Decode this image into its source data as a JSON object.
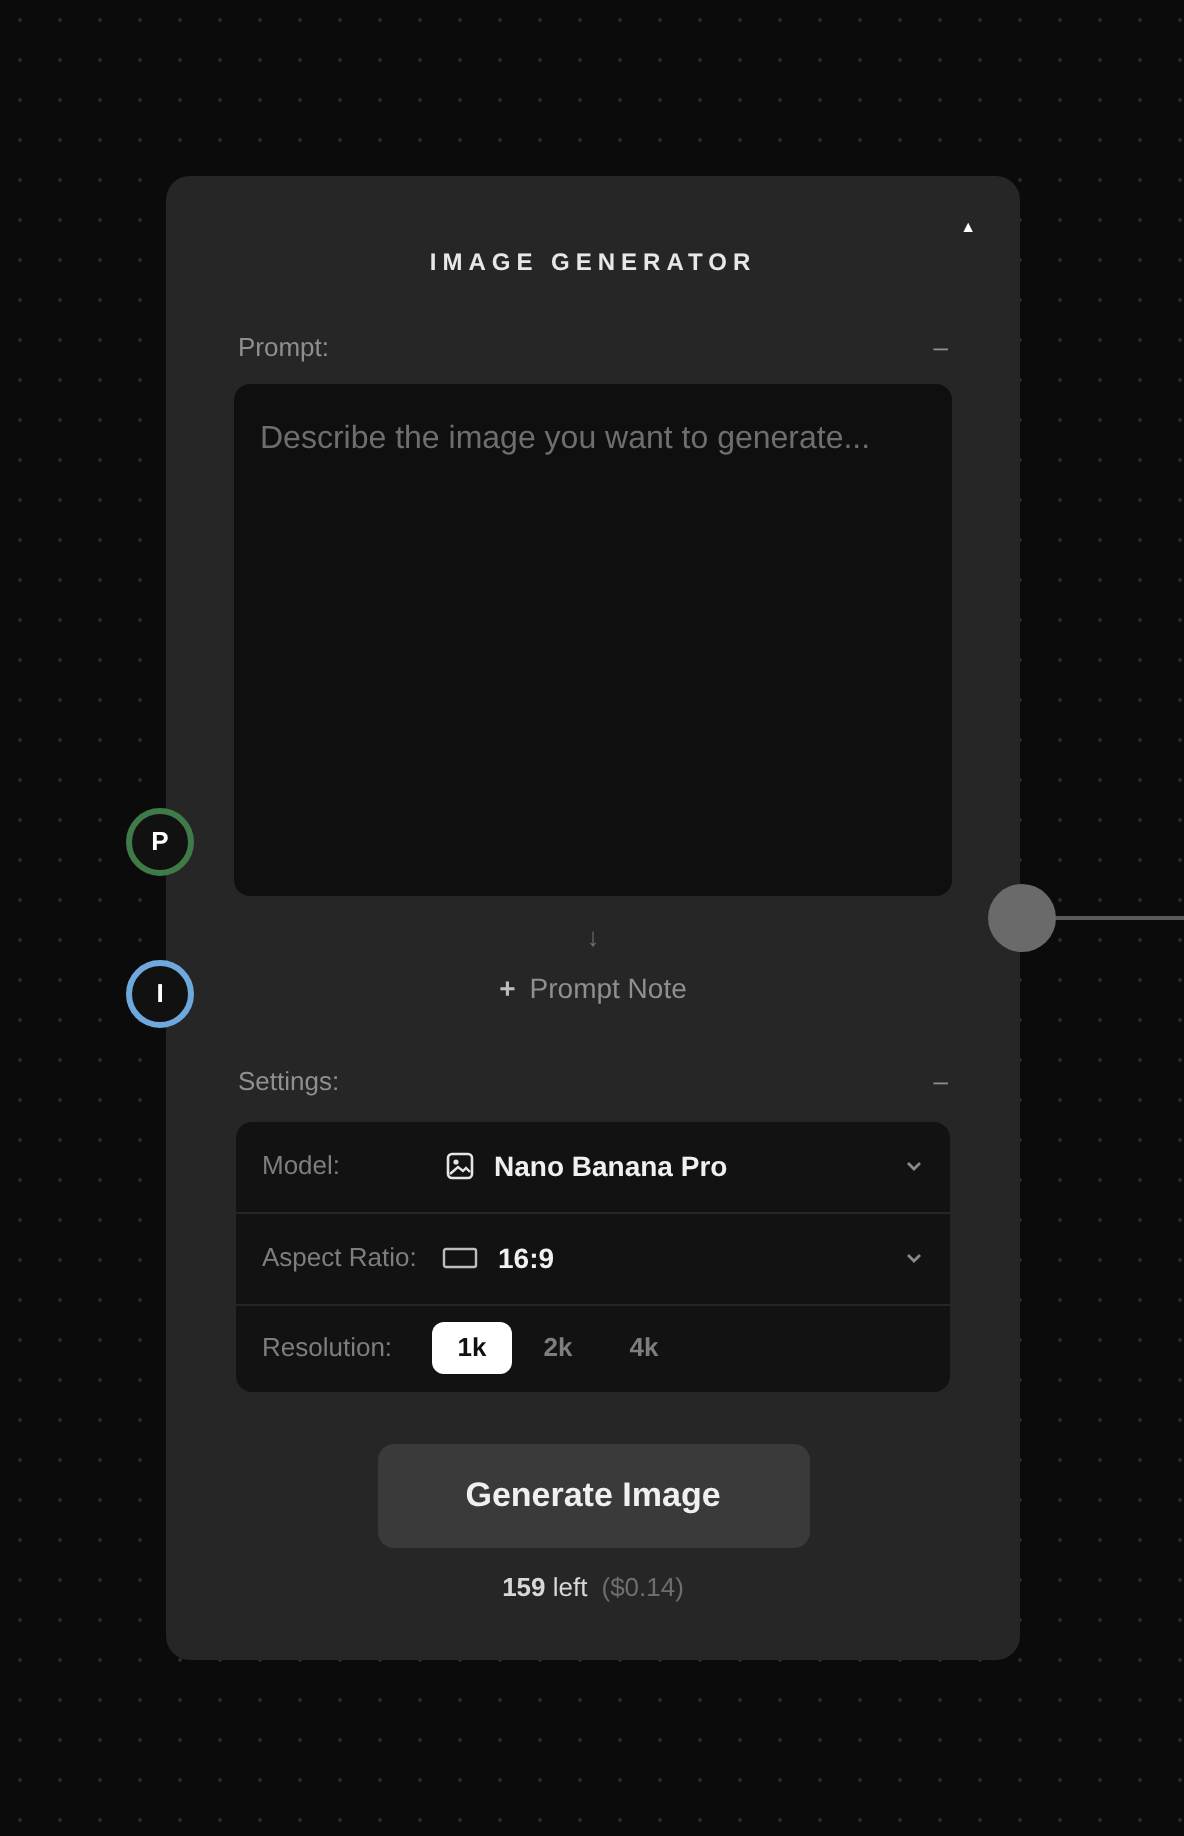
{
  "node": {
    "title": "IMAGE GENERATOR",
    "collapse_icon": "▲",
    "prompt": {
      "label": "Prompt:",
      "collapse": "–",
      "placeholder": "Describe the image you want to generate..."
    },
    "prompt_note": {
      "arrow": "↓",
      "plus": "+",
      "label": "Prompt Note"
    },
    "settings": {
      "label": "Settings:",
      "collapse": "–",
      "rows": [
        {
          "kind": "select",
          "label": "Model:",
          "value": "Nano Banana Pro"
        },
        {
          "kind": "select",
          "label": "Aspect Ratio:",
          "value": "16:9"
        },
        {
          "kind": "segmented",
          "label": "Resolution:",
          "options": [
            {
              "label": "1k",
              "selected": true
            },
            {
              "label": "2k",
              "selected": false
            },
            {
              "label": "4k",
              "selected": false
            }
          ]
        }
      ]
    },
    "button": "Generate Image",
    "credits": {
      "count": "159",
      "word": "left",
      "cost": "($0.14)"
    },
    "inputs": [
      {
        "label": "P",
        "color": "#3f7a48"
      },
      {
        "label": "I",
        "color": "#6fa8dc"
      }
    ]
  }
}
